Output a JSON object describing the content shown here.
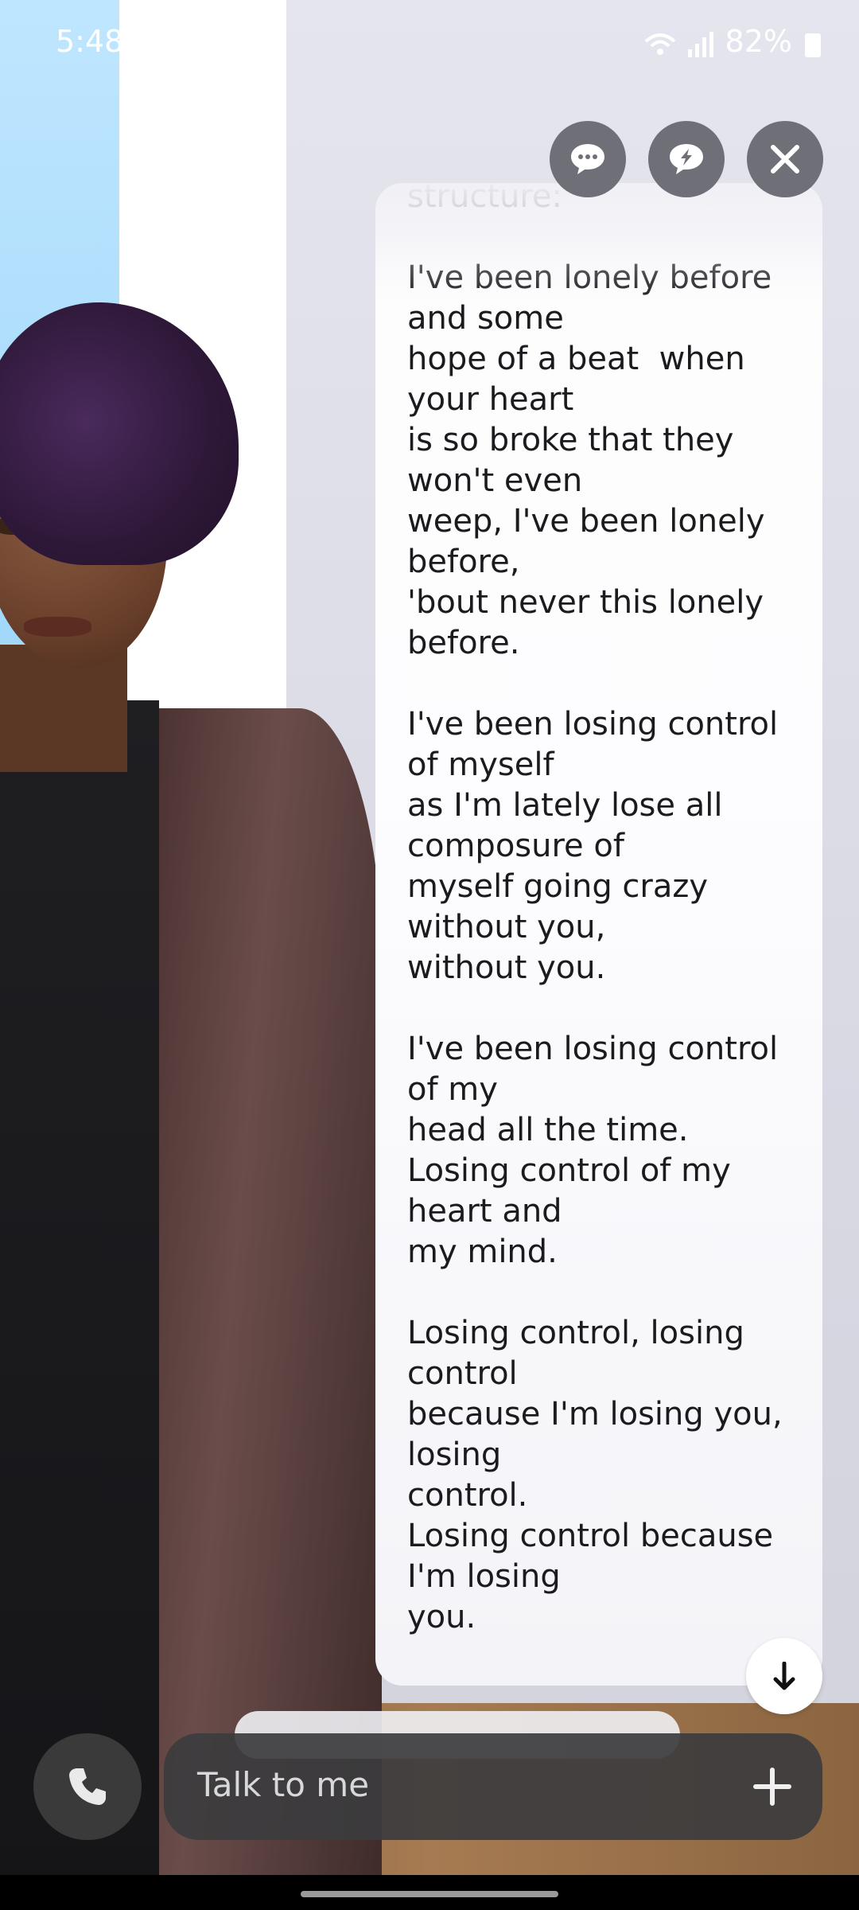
{
  "status_bar": {
    "time": "5:48",
    "battery": "82%"
  },
  "top_actions": {
    "chat_icon": "chat-bubble-icon",
    "quick_reply_icon": "lightning-bubble-icon",
    "close_icon": "close-icon"
  },
  "message": {
    "partial_top": "structure:",
    "body": "I've been lonely before\nand some\nhope of a beat  when\nyour heart\nis so broke that they\nwon't even\nweep, I've been lonely\nbefore,\n'bout never this lonely\nbefore.\n\nI've been losing control\nof myself\nas I'm lately lose all\ncomposure of\nmyself going crazy\nwithout you,\nwithout you.\n\nI've been losing control\nof my\nhead all the time.\nLosing control of my\nheart and\nmy mind.\n\nLosing control, losing\ncontrol\nbecause I'm losing you,\nlosing\ncontrol.\nLosing control because\nI'm losing\nyou."
  },
  "composer": {
    "placeholder": "Talk to me",
    "call_icon": "phone-icon",
    "add_icon": "plus-icon"
  },
  "colors": {
    "button_bg": "#6f6f78",
    "input_bg": "#3c3c3e",
    "text": "#1b1b1f"
  }
}
